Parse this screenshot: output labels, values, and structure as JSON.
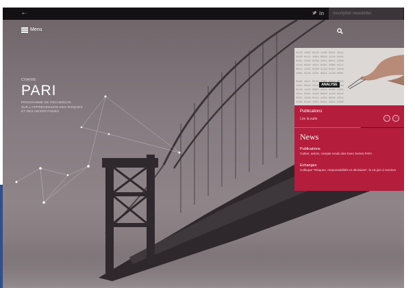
{
  "topbar": {
    "left_icon": "⇠",
    "social": {
      "twitter_icon": "twitter-icon",
      "linkedin_label": "in"
    },
    "newsletter_placeholder": "Inscription newsletter"
  },
  "menu": {
    "label": "Menu"
  },
  "hero": {
    "kicker": "CHAIRE",
    "title": "PARI",
    "subtitle_lines": [
      "PROGRAMME DE RECHERCHE",
      "SUR L'APPRÉHENSION DES RISQUES",
      "ET DES INCERTITUDES"
    ]
  },
  "publications_panel": {
    "image_caption": "ANALYSE",
    "title": "Publications",
    "link": "Lire la suite",
    "prev_arrow": "‹",
    "next_arrow": "›"
  },
  "news_panel": {
    "heading": "News",
    "items": [
      {
        "category": "Publications",
        "text": "Cahier, article, compte rendu des Exec Series PARI"
      },
      {
        "category": "Echanges",
        "text": "Colloque \"Risques, responsabilités et décisions\", le 15 juin à Genève"
      }
    ]
  },
  "colors": {
    "accent": "#b41d3c",
    "topbar": "#141114",
    "newsletter_bg": "#3b3439",
    "side_strip": "#2f4f8f"
  },
  "icons": [
    "menu-icon",
    "search-icon",
    "twitter-icon",
    "linkedin-icon",
    "back-arrow-icon",
    "chevron-left-icon",
    "chevron-right-icon"
  ]
}
